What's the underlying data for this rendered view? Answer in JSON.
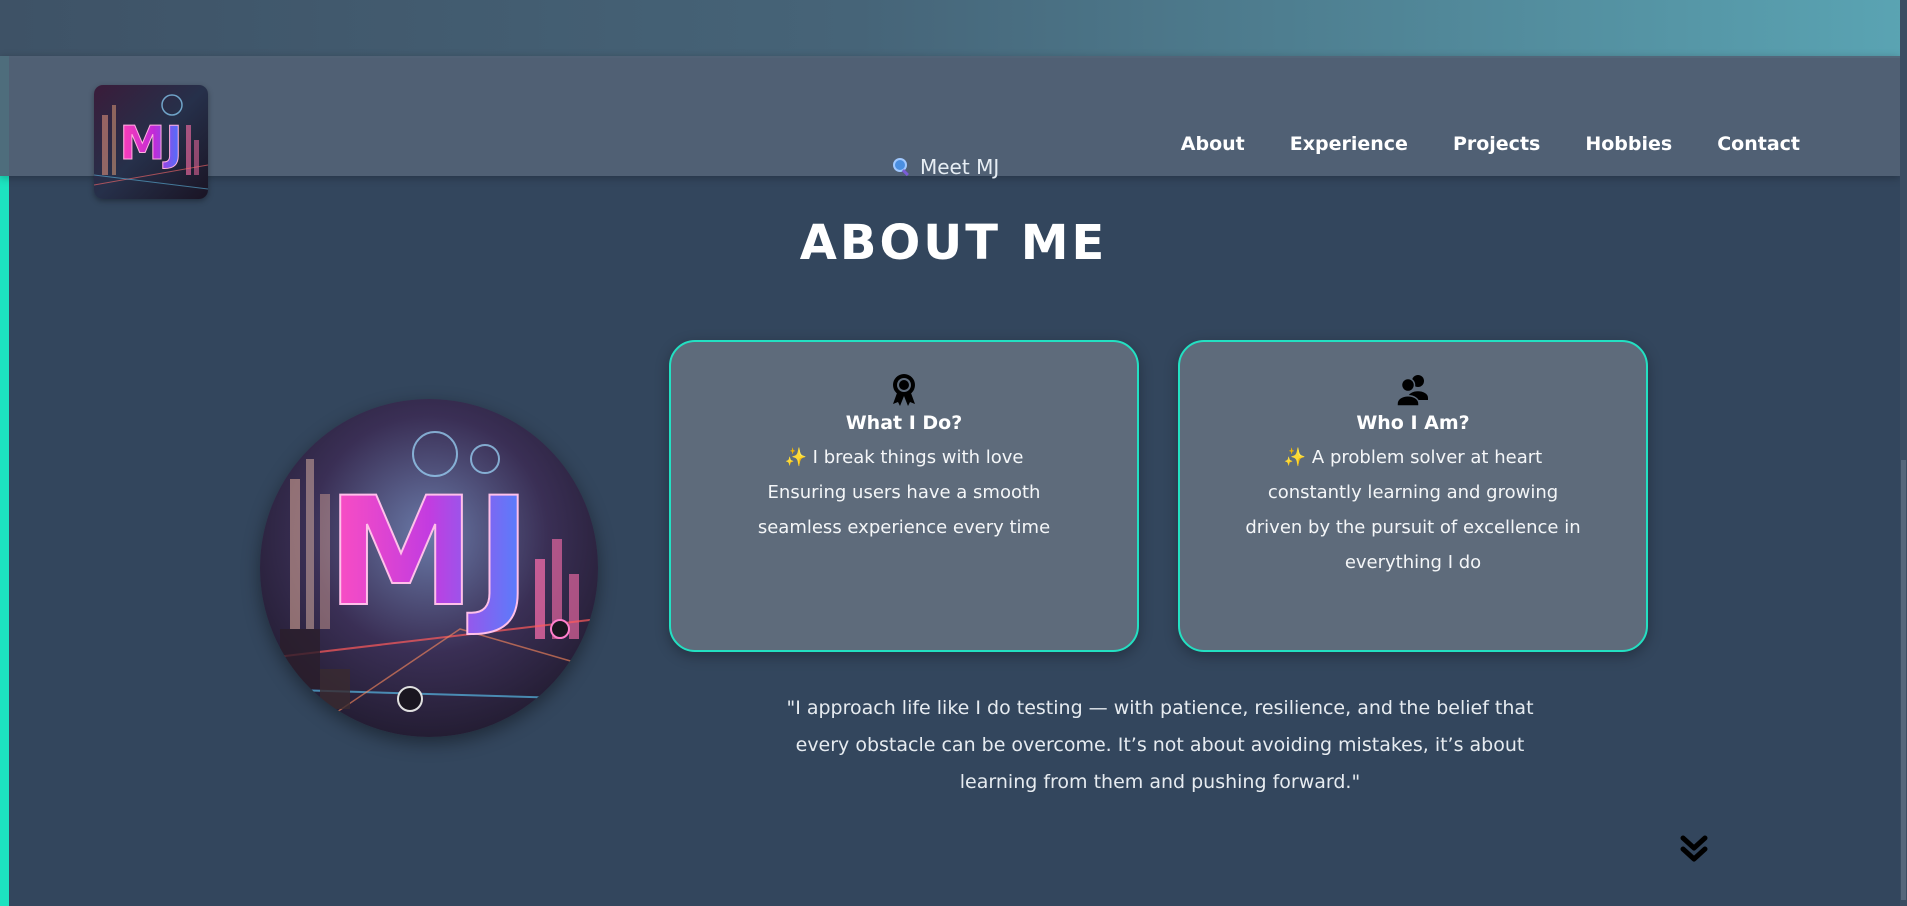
{
  "nav": {
    "items": [
      {
        "label": "About"
      },
      {
        "label": "Experience"
      },
      {
        "label": "Projects"
      },
      {
        "label": "Hobbies"
      },
      {
        "label": "Contact"
      }
    ]
  },
  "logo": {
    "text": "MJ"
  },
  "tagline": {
    "icon": "magnifier-icon",
    "text": "Meet MJ"
  },
  "section": {
    "title": "ABOUT ME"
  },
  "portrait": {
    "text": "MJ"
  },
  "cards": [
    {
      "icon": "award-icon",
      "title": "What I Do?",
      "lines": [
        "✨ I break things with love",
        "Ensuring users have a smooth",
        "seamless experience every time"
      ]
    },
    {
      "icon": "users-icon",
      "title": "Who I Am?",
      "lines": [
        "✨ A problem solver at heart",
        "constantly learning and growing",
        "driven by the pursuit of excellence in",
        "everything I do"
      ]
    }
  ],
  "quote": {
    "lines": [
      "\"I approach life like I do testing — with patience, resilience, and the belief that",
      "every obstacle can be overcome. It’s not about avoiding mistakes, it’s about",
      "learning from them and pushing forward.\""
    ]
  },
  "scroll_icon": "double-chevron-down-icon",
  "colors": {
    "background": "#33465d",
    "accent": "#1de3c0",
    "card_bg": "#5e6b7b",
    "header_bg": "#526376"
  }
}
